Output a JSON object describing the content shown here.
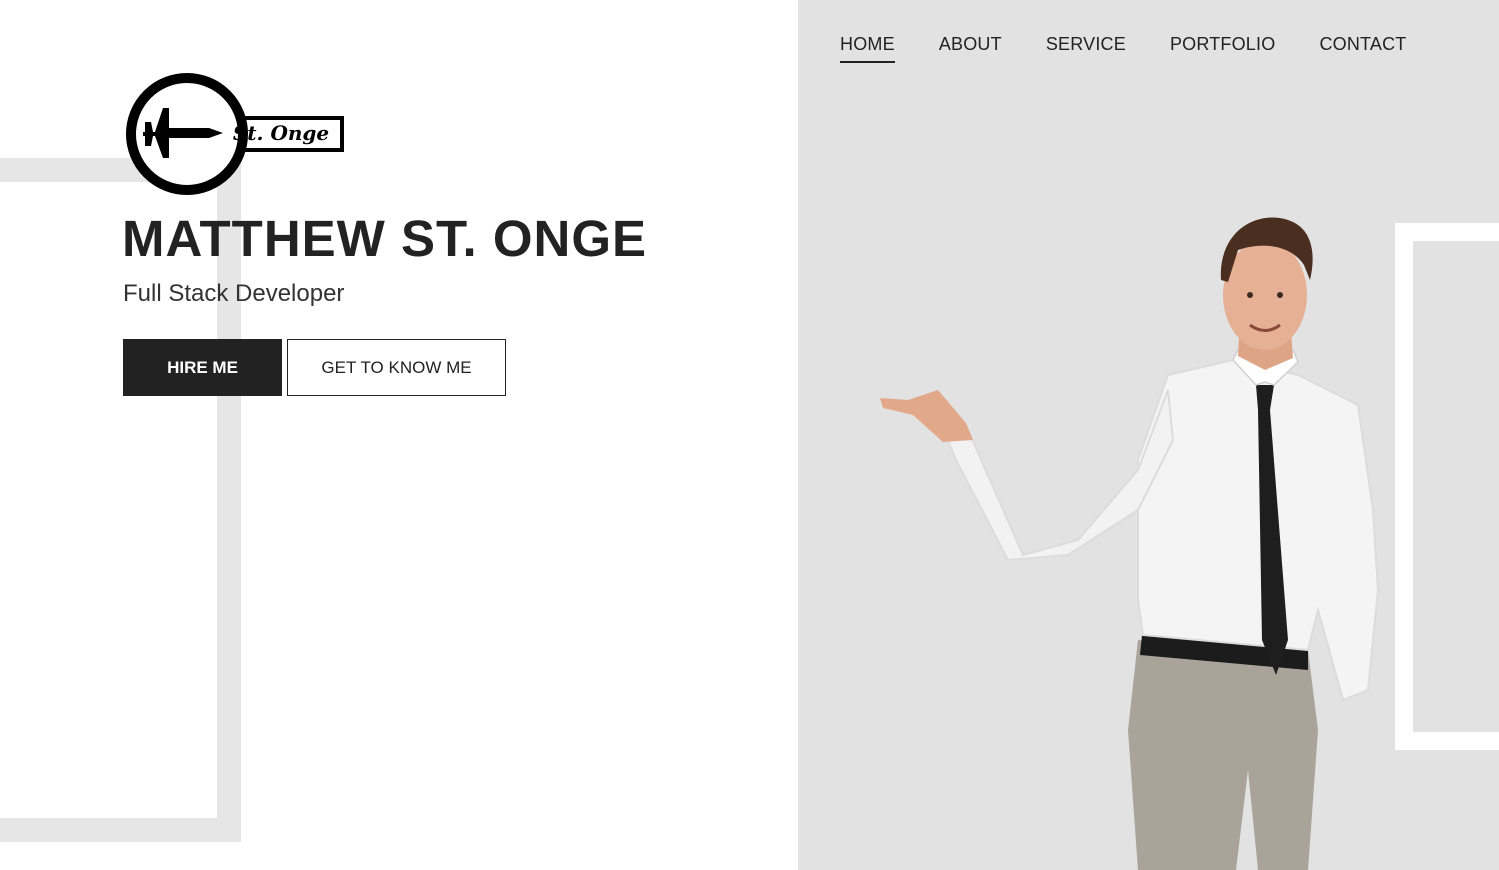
{
  "nav": {
    "items": [
      {
        "label": "HOME",
        "active": true
      },
      {
        "label": "ABOUT",
        "active": false
      },
      {
        "label": "SERVICE",
        "active": false
      },
      {
        "label": "PORTFOLIO",
        "active": false
      },
      {
        "label": "CONTACT",
        "active": false
      }
    ]
  },
  "logo": {
    "text": "St. Onge",
    "icon": "jet-plane-icon"
  },
  "hero": {
    "name": "MATTHEW ST. ONGE",
    "role": "Full Stack Developer",
    "hire_label": "HIRE ME",
    "know_label": "GET TO KNOW ME"
  },
  "colors": {
    "dark": "#222222",
    "right_bg": "#e2e2e2",
    "deco": "#e6e6e6"
  }
}
